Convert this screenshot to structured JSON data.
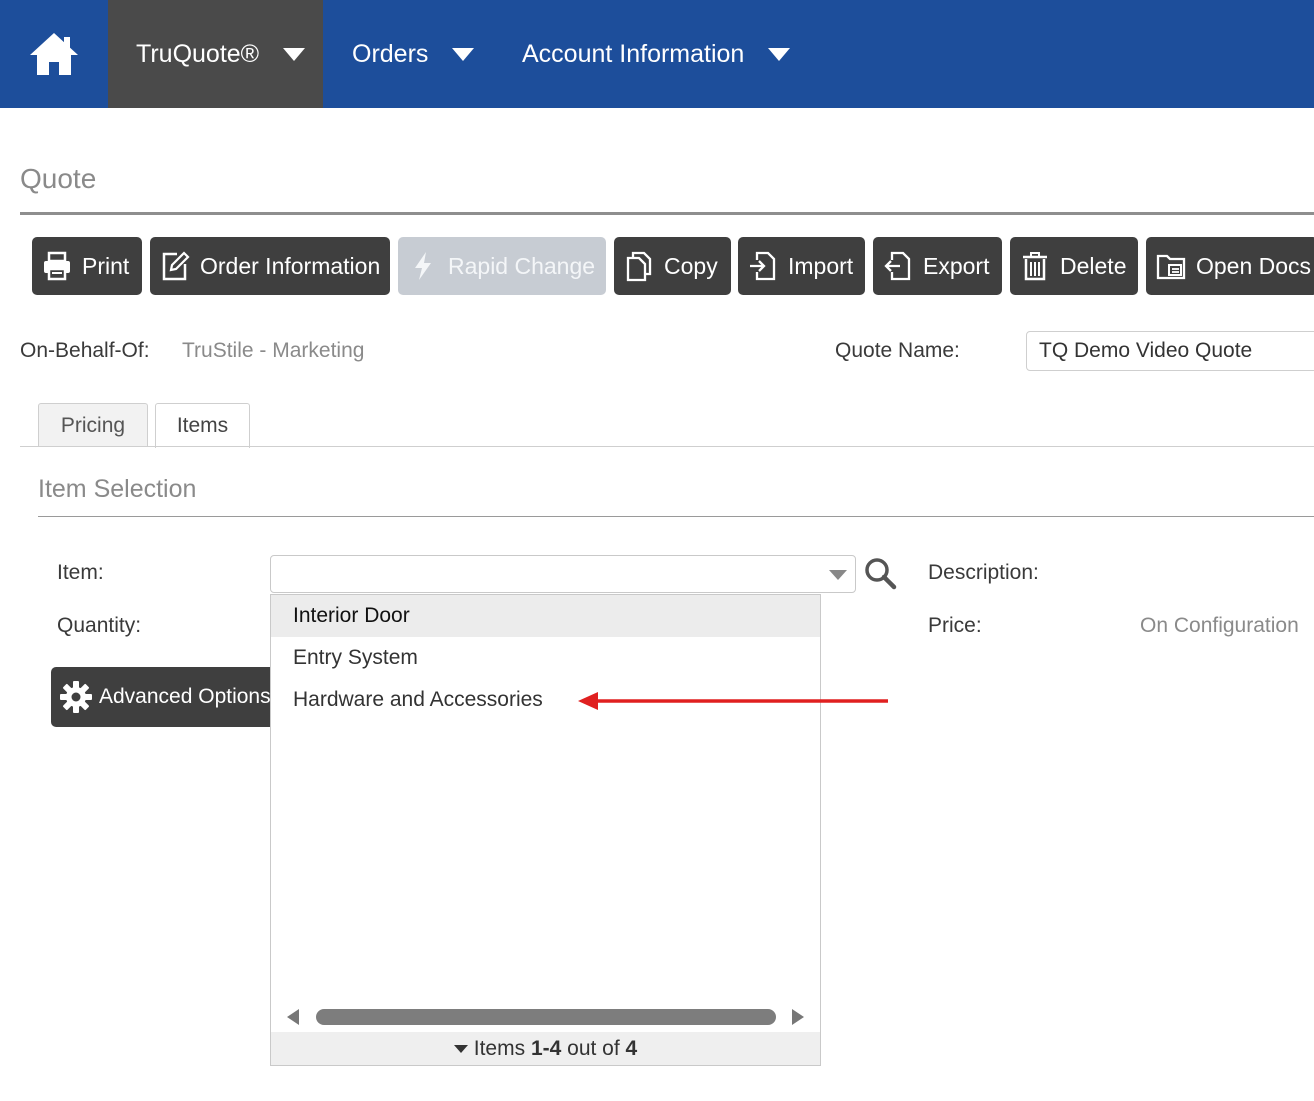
{
  "colors": {
    "nav_bg": "#1d4e9b",
    "nav_active_bg": "#4a4a4a",
    "button_bg": "#3f3f3f",
    "button_disabled_bg": "#c7ccd3",
    "annotation_arrow": "#e02020"
  },
  "nav": {
    "home_icon": "home-icon",
    "items": [
      {
        "label": "TruQuote®"
      },
      {
        "label": "Orders"
      },
      {
        "label": "Account Information"
      }
    ]
  },
  "page": {
    "title": "Quote"
  },
  "toolbar": {
    "buttons": [
      {
        "label": "Print",
        "icon": "printer-icon"
      },
      {
        "label": "Order Information",
        "icon": "edit-icon"
      },
      {
        "label": "Rapid Change",
        "icon": "lightning-icon",
        "disabled": true
      },
      {
        "label": "Copy",
        "icon": "copy-icon"
      },
      {
        "label": "Import",
        "icon": "import-icon"
      },
      {
        "label": "Export",
        "icon": "export-icon"
      },
      {
        "label": "Delete",
        "icon": "trash-icon"
      },
      {
        "label": "Open Docs",
        "icon": "folder-icon"
      }
    ]
  },
  "header_fields": {
    "on_behalf_label": "On-Behalf-Of:",
    "on_behalf_value": "TruStile - Marketing",
    "quote_name_label": "Quote Name:",
    "quote_name_value": "TQ Demo Video Quote"
  },
  "tabs": [
    {
      "label": "Pricing",
      "active": false
    },
    {
      "label": "Items",
      "active": true
    }
  ],
  "item_selection": {
    "section_title": "Item Selection",
    "item_label": "Item:",
    "item_value": "",
    "quantity_label": "Quantity:",
    "description_label": "Description:",
    "price_label": "Price:",
    "price_value": "On Configuration",
    "advanced_button_label": "Advanced Options"
  },
  "dropdown": {
    "options": [
      {
        "label": "Interior Door",
        "highlighted": true
      },
      {
        "label": "Entry System",
        "highlighted": false
      },
      {
        "label": "Hardware and Accessories",
        "highlighted": false
      }
    ],
    "footer": {
      "prefix": "Items ",
      "range": "1-4",
      "middle": " out of ",
      "total": "4"
    }
  }
}
